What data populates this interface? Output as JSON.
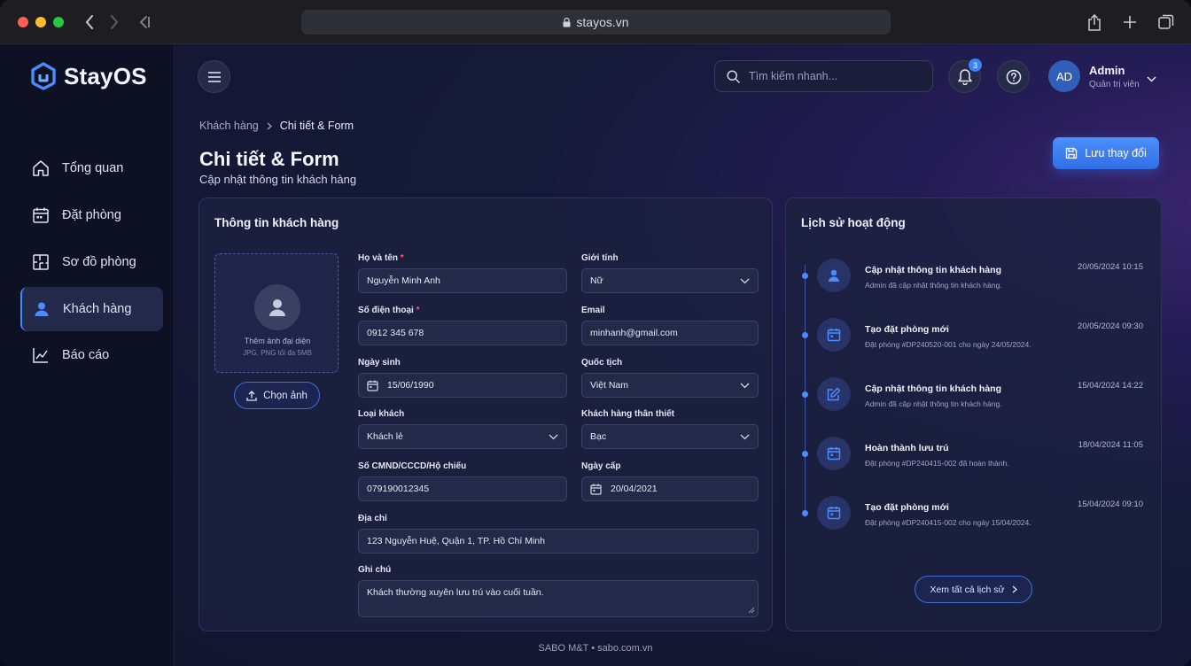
{
  "browser": {
    "url": "stayos.vn"
  },
  "brand": {
    "name": "StayOS",
    "accent": "#3b82f6"
  },
  "sidebar": {
    "items": [
      {
        "label": "Tổng quan",
        "icon": "home-icon",
        "active": false
      },
      {
        "label": "Đặt phòng",
        "icon": "calendar-icon",
        "active": false
      },
      {
        "label": "Sơ đồ phòng",
        "icon": "floorplan-icon",
        "active": false
      },
      {
        "label": "Khách hàng",
        "icon": "user-icon",
        "active": true
      },
      {
        "label": "Báo cáo",
        "icon": "chart-icon",
        "active": false
      }
    ]
  },
  "topbar": {
    "search_placeholder": "Tìm kiếm nhanh...",
    "notification_count": "3",
    "user": {
      "initials": "AD",
      "name": "Admin",
      "role": "Quản trị viên"
    }
  },
  "breadcrumb": {
    "parent": "Khách hàng",
    "current": "Chi tiết & Form"
  },
  "page": {
    "title": "Chi tiết & Form",
    "subtitle": "Cập nhật thông tin khách hàng",
    "save_label": "Lưu thay đổi"
  },
  "form": {
    "title": "Thông tin khách hàng",
    "avatar_upload": {
      "title": "Thêm ảnh đại diện",
      "hint": "JPG, PNG tối đa 5MB",
      "button": "Chọn ảnh"
    },
    "full_name": {
      "label": "Họ và tên",
      "required": "*",
      "value": "Nguyễn Minh Anh"
    },
    "gender": {
      "label": "Giới tính",
      "value": "Nữ"
    },
    "phone": {
      "label": "Số điện thoại",
      "required": "*",
      "value": "0912 345 678"
    },
    "email": {
      "label": "Email",
      "value": "minhanh@gmail.com"
    },
    "birthday": {
      "label": "Ngày sinh",
      "value": "15/06/1990"
    },
    "nationality": {
      "label": "Quốc tịch",
      "value": "Việt Nam"
    },
    "guest_type": {
      "label": "Loại khách",
      "value": "Khách lẻ"
    },
    "loyalty": {
      "label": "Khách hàng thân thiết",
      "value": "Bạc"
    },
    "id_number": {
      "label": "Số CMND/CCCD/Hộ chiếu",
      "value": "079190012345"
    },
    "issue_date": {
      "label": "Ngày cấp",
      "value": "20/04/2021"
    },
    "address": {
      "label": "Địa chỉ",
      "value": "123 Nguyễn Huệ, Quận 1, TP. Hồ Chí Minh"
    },
    "note": {
      "label": "Ghi chú",
      "value": "Khách thường xuyên lưu trú vào cuối tuần."
    }
  },
  "activity": {
    "title": "Lịch sử hoạt động",
    "items": [
      {
        "icon": "user-icon",
        "title": "Cập nhật thông tin khách hàng",
        "desc": "Admin đã cập nhật thông tin khách hàng.",
        "time": "20/05/2024 10:15"
      },
      {
        "icon": "calendar-icon",
        "title": "Tạo đặt phòng mới",
        "desc": "Đặt phòng #DP240520-001 cho ngày 24/05/2024.",
        "time": "20/05/2024 09:30"
      },
      {
        "icon": "edit-icon",
        "title": "Cập nhật thông tin khách hàng",
        "desc": "Admin đã cập nhật thông tin khách hàng.",
        "time": "15/04/2024 14:22"
      },
      {
        "icon": "calendar-icon",
        "title": "Hoàn thành lưu trú",
        "desc": "Đặt phòng #DP240415-002 đã hoàn thành.",
        "time": "18/04/2024 11:05"
      },
      {
        "icon": "calendar-icon",
        "title": "Tạo đặt phòng mới",
        "desc": "Đặt phòng #DP240415-002 cho ngày 15/04/2024.",
        "time": "15/04/2024 09:10"
      }
    ],
    "view_all_label": "Xem tất cả lịch sử"
  },
  "footer": {
    "text": "SABO M&T • sabo.com.vn"
  }
}
